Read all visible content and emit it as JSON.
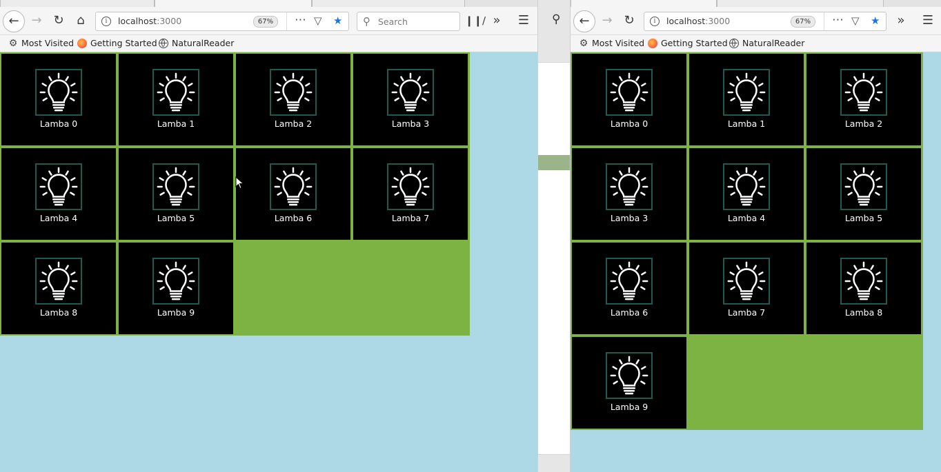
{
  "left_window": {
    "url": {
      "host": "localhost",
      "port": ":3000"
    },
    "zoom": "67%",
    "search_placeholder": "Search",
    "bookmarks": [
      "Most Visited",
      "Getting Started",
      "NaturalReader"
    ],
    "lamps": [
      "Lamba 0",
      "Lamba 1",
      "Lamba 2",
      "Lamba 3",
      "Lamba 4",
      "Lamba 5",
      "Lamba 6",
      "Lamba 7",
      "Lamba 8",
      "Lamba 9"
    ]
  },
  "right_window": {
    "url": {
      "host": "localhost",
      "port": ":3000"
    },
    "zoom": "67%",
    "bookmarks": [
      "Most Visited",
      "Getting Started",
      "NaturalReader"
    ],
    "lamps": [
      "Lamba 0",
      "Lamba 1",
      "Lamba 2",
      "Lamba 3",
      "Lamba 4",
      "Lamba 5",
      "Lamba 6",
      "Lamba 7",
      "Lamba 8",
      "Lamba 9"
    ]
  },
  "colors": {
    "page_background": "#add8e6",
    "tile_background": "#000000",
    "tile_border": "#7cb342",
    "bulb_frame": "#1f5a52",
    "bookmark_star": "#1a73e8"
  },
  "icons": {
    "lamp": "lightbulb-icon",
    "back": "back-arrow-icon",
    "forward": "forward-arrow-icon",
    "reload": "reload-icon",
    "home": "home-icon",
    "more": "more-icon",
    "pocket": "pocket-icon",
    "bookmark": "star-icon",
    "library": "library-icon",
    "overflow": "chevron-double-right-icon",
    "menu": "hamburger-menu-icon"
  }
}
